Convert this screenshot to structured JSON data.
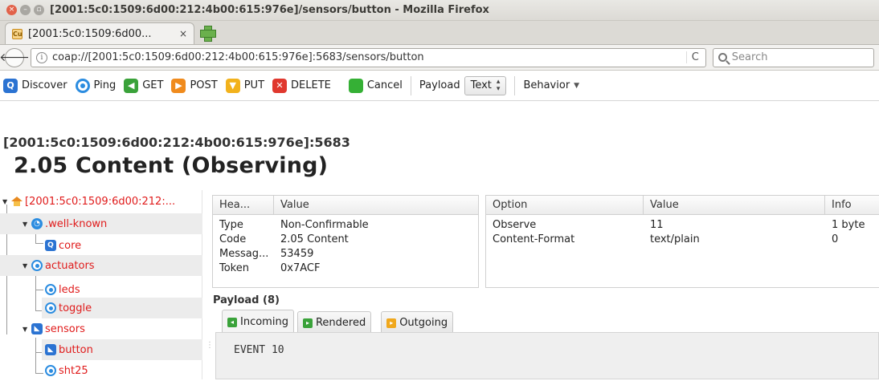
{
  "window": {
    "title": "[2001:5c0:1509:6d00:212:4b00:615:976e]/sensors/button - Mozilla Firefox",
    "controls": [
      "×",
      "–",
      "▫"
    ]
  },
  "tab": {
    "label": "[2001:5c0:1509:6d00... ",
    "close": "×"
  },
  "nav": {
    "back": "🡐",
    "url": "coap://[2001:5c0:1509:6d00:212:4b00:615:976e]:5683/sensors/button",
    "reload": "C",
    "search_placeholder": "Search"
  },
  "toolbar": {
    "discover": "Discover",
    "ping": "Ping",
    "get": "GET",
    "post": "POST",
    "put": "PUT",
    "delete": "DELETE",
    "cancel": "Cancel",
    "payload_label": "Payload",
    "payload_format": "Text",
    "behavior": "Behavior"
  },
  "response": {
    "origin": "[2001:5c0:1509:6d00:212:4b00:615:976e]:5683",
    "status": "2.05 Content (Observing)"
  },
  "tree": {
    "root": "[2001:5c0:1509:6d00:212:...",
    "well_known": ".well-known",
    "core": "core",
    "actuators": "actuators",
    "leds": "leds",
    "toggle": "toggle",
    "sensors": "sensors",
    "button": "button",
    "sht25": "sht25"
  },
  "headers": {
    "columns": [
      "Hea...",
      "Value"
    ],
    "rows": [
      [
        "Type",
        "Non-Confirmable"
      ],
      [
        "Code",
        "2.05 Content"
      ],
      [
        "Messag...",
        "53459"
      ],
      [
        "Token",
        "0x7ACF"
      ]
    ]
  },
  "options": {
    "columns": [
      "Option",
      "Value",
      "Info"
    ],
    "rows": [
      [
        "Observe",
        "11",
        "1 byte"
      ],
      [
        "Content-Format",
        "text/plain",
        "0"
      ]
    ]
  },
  "payload": {
    "label": "Payload (8)",
    "tabs": [
      "Incoming",
      "Rendered",
      "Outgoing"
    ],
    "active_tab": "Incoming",
    "content": "EVENT 10"
  },
  "colors": {
    "tree_link": "#e01b1b",
    "accent_blue": "#2b73d2"
  }
}
